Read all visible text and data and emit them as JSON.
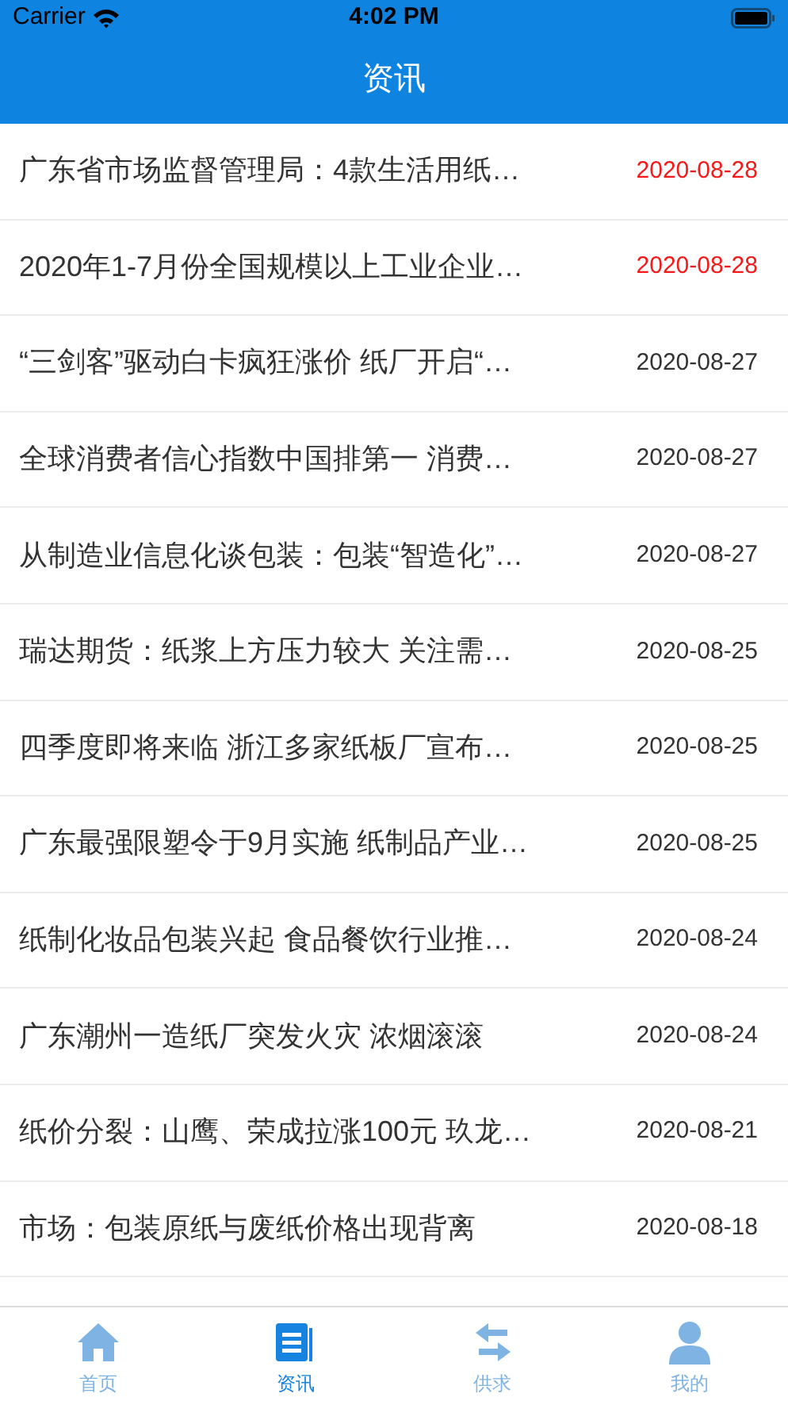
{
  "status_bar": {
    "carrier": "Carrier",
    "time": "4:02 PM"
  },
  "nav_bar": {
    "title": "资讯"
  },
  "news": [
    {
      "title": "广东省市场监督管理局：4款生活用纸…",
      "date": "2020-08-28",
      "highlighted": true
    },
    {
      "title": "2020年1-7月份全国规模以上工业企业…",
      "date": "2020-08-28",
      "highlighted": true
    },
    {
      "title": "“三剑客”驱动白卡疯狂涨价 纸厂开启“…",
      "date": "2020-08-27",
      "highlighted": false
    },
    {
      "title": "全球消费者信心指数中国排第一 消费…",
      "date": "2020-08-27",
      "highlighted": false
    },
    {
      "title": "从制造业信息化谈包装：包装“智造化”…",
      "date": "2020-08-27",
      "highlighted": false
    },
    {
      "title": "瑞达期货：纸浆上方压力较大 关注需…",
      "date": "2020-08-25",
      "highlighted": false
    },
    {
      "title": "四季度即将来临 浙江多家纸板厂宣布…",
      "date": "2020-08-25",
      "highlighted": false
    },
    {
      "title": "广东最强限塑令于9月实施 纸制品产业…",
      "date": "2020-08-25",
      "highlighted": false
    },
    {
      "title": "纸制化妆品包装兴起 食品餐饮行业推…",
      "date": "2020-08-24",
      "highlighted": false
    },
    {
      "title": "广东潮州一造纸厂突发火灾 浓烟滚滚",
      "date": "2020-08-24",
      "highlighted": false
    },
    {
      "title": "纸价分裂：山鹰、荣成拉涨100元 玖龙…",
      "date": "2020-08-21",
      "highlighted": false
    },
    {
      "title": "市场：包装原纸与废纸价格出现背离",
      "date": "2020-08-18",
      "highlighted": false
    }
  ],
  "tab_bar": [
    {
      "kind": "home",
      "label": "首页",
      "selected": false
    },
    {
      "kind": "news",
      "label": "资讯",
      "selected": true
    },
    {
      "kind": "exchange",
      "label": "供求",
      "selected": false
    },
    {
      "kind": "profile",
      "label": "我的",
      "selected": false
    }
  ]
}
